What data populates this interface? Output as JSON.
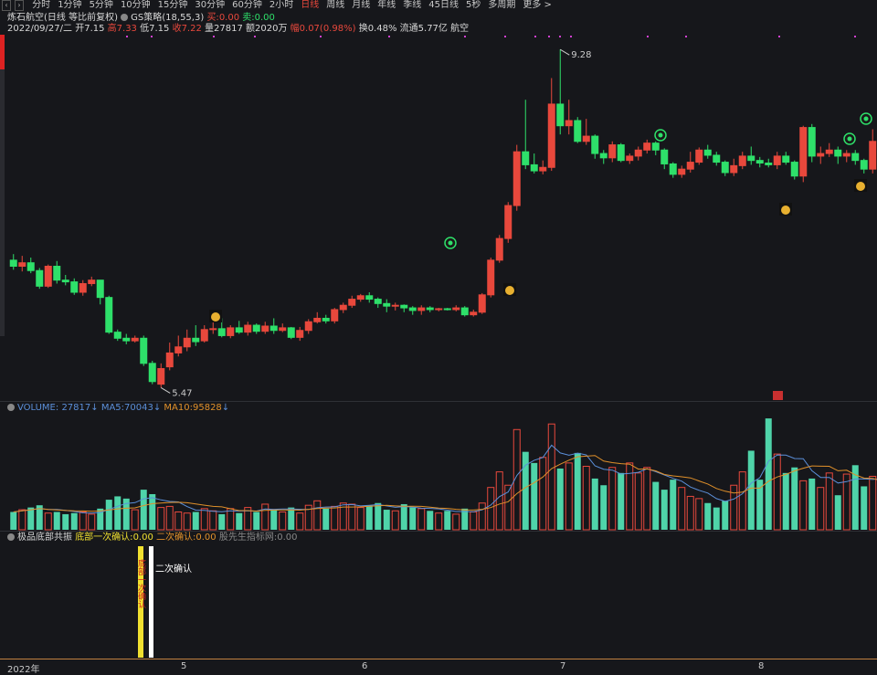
{
  "toolbar": {
    "periods": [
      "分时",
      "1分钟",
      "5分钟",
      "10分钟",
      "15分钟",
      "30分钟",
      "60分钟",
      "2小时",
      "日线",
      "周线",
      "月线",
      "年线",
      "季线",
      "45日线",
      "5秒",
      "多周期",
      "更多 >"
    ],
    "active_period": "日线"
  },
  "header": {
    "stock_name": "炼石航空(日线 等比前复权)",
    "strategy_label": "GS策略(18,55,3)",
    "buy_label": "买:",
    "buy_value": "0.00",
    "sell_label": "卖:",
    "sell_value": "0.00",
    "date": "2022/09/27/二",
    "open_label": "开",
    "open": "7.15",
    "high_label": "高",
    "high": "7.33",
    "low_label": "低",
    "low": "7.15",
    "close_label": "收",
    "close": "7.22",
    "volume_label": "量",
    "volume": "27817",
    "amount_label": "额",
    "amount": "2020万",
    "change_label": "幅",
    "change": "0.07(0.98%)",
    "turnover_label": "换",
    "turnover": "0.48%",
    "float_label": "流通",
    "float": "5.77亿",
    "sector": "航空"
  },
  "price_annotations": {
    "high_marker": "9.28",
    "low_marker": "5.47"
  },
  "volume_panel": {
    "name": "VOLUME:",
    "value": "27817",
    "ma5_label": "MA5:",
    "ma5": "70043",
    "ma10_label": "MA10:",
    "ma10": "95828"
  },
  "indicator_panel": {
    "name": "极品底部共振",
    "first_label": "底部一次确认:",
    "first_value": "0.00",
    "second_label": "二次确认:",
    "second_value": "0.00",
    "source": "股先生指标网:",
    "source_value": "0.00",
    "bar_text": "二次确认"
  },
  "x_axis": [
    "2022年",
    "5",
    "6",
    "7",
    "8"
  ],
  "colors": {
    "up": "#e8483c",
    "down": "#2ee06a",
    "ma5": "#5b8fd9",
    "ma10": "#e0902a",
    "vol_up": "#e8483c",
    "vol_down": "#4fd4a9",
    "bg": "#16171b"
  },
  "chart_data": {
    "type": "candlestick",
    "candles": [
      [
        6.85,
        6.78,
        6.92,
        6.74
      ],
      [
        6.78,
        6.82,
        6.9,
        6.72
      ],
      [
        6.82,
        6.73,
        6.88,
        6.7
      ],
      [
        6.73,
        6.55,
        6.76,
        6.52
      ],
      [
        6.55,
        6.78,
        6.8,
        6.53
      ],
      [
        6.78,
        6.62,
        6.84,
        6.58
      ],
      [
        6.62,
        6.6,
        6.68,
        6.56
      ],
      [
        6.6,
        6.48,
        6.64,
        6.45
      ],
      [
        6.48,
        6.58,
        6.62,
        6.44
      ],
      [
        6.58,
        6.62,
        6.66,
        6.55
      ],
      [
        6.62,
        6.42,
        6.62,
        6.34
      ],
      [
        6.42,
        6.02,
        6.44,
        6.0
      ],
      [
        6.02,
        5.95,
        6.05,
        5.92
      ],
      [
        5.95,
        5.92,
        6.0,
        5.88
      ],
      [
        5.92,
        5.95,
        5.98,
        5.9
      ],
      [
        5.95,
        5.66,
        5.98,
        5.63
      ],
      [
        5.66,
        5.45,
        5.69,
        5.42
      ],
      [
        5.42,
        5.6,
        5.66,
        5.38
      ],
      [
        5.62,
        5.78,
        5.9,
        5.58
      ],
      [
        5.78,
        5.85,
        5.98,
        5.74
      ],
      [
        5.85,
        5.95,
        6.05,
        5.8
      ],
      [
        5.95,
        5.91,
        6.1,
        5.86
      ],
      [
        5.92,
        6.05,
        6.1,
        5.9
      ],
      [
        6.05,
        6.06,
        6.15,
        6.0
      ],
      [
        6.06,
        5.98,
        6.18,
        5.96
      ],
      [
        5.98,
        6.07,
        6.1,
        5.95
      ],
      [
        6.07,
        6.02,
        6.15,
        6.0
      ],
      [
        6.02,
        6.1,
        6.14,
        5.98
      ],
      [
        6.1,
        6.03,
        6.12,
        6.0
      ],
      [
        6.03,
        6.09,
        6.14,
        6.0
      ],
      [
        6.09,
        6.04,
        6.18,
        6.0
      ],
      [
        6.04,
        6.07,
        6.12,
        6.02
      ],
      [
        6.07,
        5.96,
        6.08,
        5.94
      ],
      [
        5.96,
        6.04,
        6.08,
        5.92
      ],
      [
        6.04,
        6.14,
        6.17,
        6.0
      ],
      [
        6.14,
        6.18,
        6.25,
        6.12
      ],
      [
        6.18,
        6.15,
        6.22,
        6.12
      ],
      [
        6.15,
        6.28,
        6.3,
        6.12
      ],
      [
        6.28,
        6.33,
        6.36,
        6.24
      ],
      [
        6.33,
        6.4,
        6.44,
        6.3
      ],
      [
        6.4,
        6.44,
        6.46,
        6.37
      ],
      [
        6.44,
        6.4,
        6.48,
        6.36
      ],
      [
        6.4,
        6.35,
        6.42,
        6.3
      ],
      [
        6.35,
        6.32,
        6.4,
        6.25
      ],
      [
        6.32,
        6.33,
        6.36,
        6.27
      ],
      [
        6.33,
        6.3,
        6.34,
        6.25
      ],
      [
        6.3,
        6.27,
        6.32,
        6.22
      ],
      [
        6.27,
        6.3,
        6.33,
        6.22
      ],
      [
        6.3,
        6.28,
        6.32,
        6.25
      ],
      [
        6.28,
        6.29,
        6.3,
        6.26
      ],
      [
        6.29,
        6.28,
        6.3,
        6.27
      ],
      [
        6.28,
        6.3,
        6.33,
        6.26
      ],
      [
        6.3,
        6.22,
        6.32,
        6.2
      ],
      [
        6.22,
        6.25,
        6.28,
        6.2
      ],
      [
        6.25,
        6.45,
        6.47,
        6.23
      ],
      [
        6.45,
        6.85,
        6.88,
        6.42
      ],
      [
        6.85,
        7.1,
        7.14,
        6.82
      ],
      [
        7.1,
        7.48,
        7.52,
        7.05
      ],
      [
        7.48,
        8.1,
        8.18,
        7.42
      ],
      [
        8.1,
        7.95,
        8.7,
        7.9
      ],
      [
        7.95,
        7.88,
        8.08,
        7.85
      ],
      [
        7.88,
        7.92,
        8.0,
        7.84
      ],
      [
        7.92,
        8.65,
        8.95,
        7.88
      ],
      [
        8.65,
        8.4,
        9.28,
        8.3
      ],
      [
        8.4,
        8.46,
        8.7,
        8.3
      ],
      [
        8.46,
        8.22,
        8.5,
        8.2
      ],
      [
        8.22,
        8.28,
        8.48,
        8.18
      ],
      [
        8.28,
        8.08,
        8.3,
        8.02
      ],
      [
        8.08,
        8.03,
        8.12,
        7.96
      ],
      [
        8.03,
        8.18,
        8.22,
        7.98
      ],
      [
        8.18,
        8.0,
        8.2,
        7.98
      ],
      [
        8.0,
        8.05,
        8.08,
        7.96
      ],
      [
        8.05,
        8.12,
        8.16,
        8.0
      ],
      [
        8.12,
        8.2,
        8.24,
        8.08
      ],
      [
        8.2,
        8.12,
        8.22,
        8.06
      ],
      [
        8.12,
        7.96,
        8.14,
        7.9
      ],
      [
        7.96,
        7.84,
        7.98,
        7.8
      ],
      [
        7.84,
        7.9,
        7.94,
        7.8
      ],
      [
        7.9,
        7.98,
        8.1,
        7.86
      ],
      [
        7.98,
        8.12,
        8.15,
        7.95
      ],
      [
        8.12,
        8.06,
        8.18,
        8.02
      ],
      [
        8.06,
        7.98,
        8.1,
        7.94
      ],
      [
        7.98,
        7.86,
        8.0,
        7.82
      ],
      [
        7.86,
        7.94,
        8.02,
        7.82
      ],
      [
        7.94,
        8.05,
        8.1,
        7.9
      ],
      [
        8.05,
        8.0,
        8.16,
        7.95
      ],
      [
        8.0,
        7.97,
        8.04,
        7.92
      ],
      [
        7.97,
        7.95,
        8.02,
        7.92
      ],
      [
        7.95,
        8.05,
        8.1,
        7.9
      ],
      [
        8.05,
        7.98,
        8.1,
        7.95
      ],
      [
        7.98,
        7.82,
        8.0,
        7.78
      ],
      [
        7.82,
        8.38,
        8.4,
        7.75
      ],
      [
        8.38,
        8.05,
        8.42,
        7.98
      ],
      [
        8.05,
        8.08,
        8.16,
        7.96
      ],
      [
        8.08,
        8.12,
        8.2,
        8.04
      ],
      [
        8.12,
        8.05,
        8.16,
        7.96
      ],
      [
        8.05,
        8.08,
        8.12,
        7.98
      ],
      [
        8.08,
        8.0,
        8.12,
        7.95
      ],
      [
        8.0,
        7.9,
        8.02,
        7.85
      ],
      [
        7.9,
        8.22,
        8.36,
        7.85
      ],
      [
        8.22,
        8.3,
        8.38,
        8.18
      ],
      [
        8.3,
        8.08,
        8.36,
        8.04
      ]
    ],
    "volumes": [
      1.6,
      1.8,
      2.0,
      2.2,
      1.5,
      1.6,
      1.4,
      1.5,
      1.6,
      1.4,
      1.9,
      2.7,
      3.0,
      2.8,
      1.8,
      3.6,
      3.2,
      2.0,
      2.1,
      1.6,
      1.5,
      1.6,
      1.9,
      1.7,
      1.4,
      1.9,
      1.5,
      2.0,
      1.6,
      2.3,
      1.8,
      1.6,
      2.0,
      1.5,
      2.2,
      2.6,
      1.9,
      2.1,
      2.4,
      2.3,
      2.0,
      2.2,
      2.4,
      1.8,
      1.7,
      2.3,
      2.0,
      1.9,
      1.7,
      1.5,
      1.7,
      1.4,
      1.9,
      1.6,
      2.4,
      3.8,
      5.2,
      4.0,
      9.0,
      7.0,
      6.0,
      6.5,
      9.5,
      5.5,
      6.0,
      6.9,
      5.7,
      4.6,
      4.0,
      5.6,
      5.1,
      6.0,
      5.1,
      5.6,
      4.3,
      3.6,
      4.5,
      3.8,
      3.0,
      2.8,
      2.4,
      2.0,
      2.6,
      4.0,
      5.2,
      7.1,
      4.5,
      10.0,
      6.8,
      5.1,
      5.6,
      4.4,
      4.6,
      3.8,
      5.1,
      3.1,
      5.0,
      5.8,
      3.9,
      4.8,
      3.5,
      3.5
    ],
    "volume_unit": "×10^4",
    "price_range": [
      5.3,
      9.45
    ],
    "x_axis_labels": [
      "2022年",
      "5",
      "6",
      "7",
      "8"
    ],
    "high_label": 9.28,
    "low_label": 5.47
  }
}
